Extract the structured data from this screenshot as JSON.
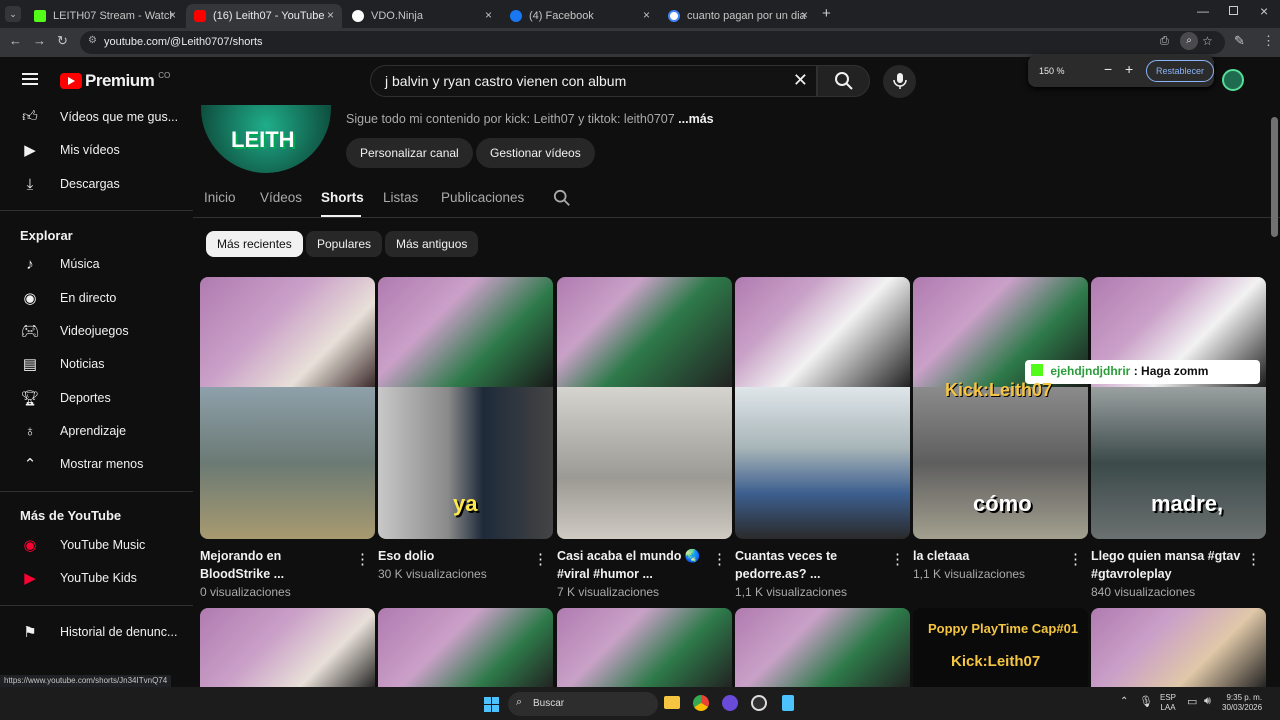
{
  "browser": {
    "tabs": [
      {
        "title": "LEITH07 Stream - Watch Live on",
        "color": "#53fc18"
      },
      {
        "title": "(16) Leith07 - YouTube",
        "color": "#ff0000"
      },
      {
        "title": "VDO.Ninja",
        "color": "#ffffff"
      },
      {
        "title": "(4) Facebook",
        "color": "#1877f2"
      },
      {
        "title": "cuanto pagan por un dia de tra",
        "color": "#4285f4"
      }
    ],
    "url": "youtube.com/@Leith0707/shorts",
    "zoom": {
      "value": "150 %",
      "reset": "Restablecer"
    }
  },
  "yt": {
    "logo": "Premium",
    "country": "CO",
    "search_value": "j balvin y ryan castro vienen con album"
  },
  "sidebar": {
    "top_items": [
      {
        "label": "Vídeos que me gus...",
        "icon": "like-icon"
      },
      {
        "label": "Mis vídeos",
        "icon": "play-square-icon"
      },
      {
        "label": "Descargas",
        "icon": "download-icon"
      }
    ],
    "explore_header": "Explorar",
    "explore_items": [
      {
        "label": "Música",
        "icon": "music-icon"
      },
      {
        "label": "En directo",
        "icon": "live-icon"
      },
      {
        "label": "Videojuegos",
        "icon": "gamepad-icon"
      },
      {
        "label": "Noticias",
        "icon": "news-icon"
      },
      {
        "label": "Deportes",
        "icon": "trophy-icon"
      },
      {
        "label": "Aprendizaje",
        "icon": "bulb-icon"
      },
      {
        "label": "Mostrar menos",
        "icon": "chevron-up-icon"
      }
    ],
    "more_header": "Más de YouTube",
    "more_items": [
      {
        "label": "YouTube Music"
      },
      {
        "label": "YouTube Kids"
      }
    ],
    "report_history": "Historial de denunc..."
  },
  "channel": {
    "description": "Sigue todo mi contenido por kick: Leith07 y tiktok: leith0707",
    "more": "...más",
    "avatar_text": "LEITH",
    "customize": "Personalizar canal",
    "manage": "Gestionar vídeos",
    "tabs": [
      "Inicio",
      "Vídeos",
      "Shorts",
      "Listas",
      "Publicaciones"
    ],
    "active_tab": "Shorts"
  },
  "filters": [
    "Más recientes",
    "Populares",
    "Más antiguos"
  ],
  "shorts": [
    {
      "title": "Mejorando en BloodStrike ...",
      "views": "0 visualizaciones",
      "caption": ""
    },
    {
      "title": "Eso dolio",
      "views": "30 K visualizaciones",
      "caption": "ya"
    },
    {
      "title": "Casi acaba el mundo 🌏 #viral #humor ...",
      "views": "7 K visualizaciones",
      "caption": ""
    },
    {
      "title": "Cuantas veces te pedorre.as? ...",
      "views": "1,1 K visualizaciones",
      "caption": ""
    },
    {
      "title": "la cletaaa",
      "views": "1,1 K visualizaciones",
      "caption": "cómo"
    },
    {
      "title": "Llego quien mansa #gtav #gtavroleplay",
      "views": "840 visualizaciones",
      "caption": "madre,"
    }
  ],
  "overlays": {
    "kick_chat_user": "ejehdjndjdhrir",
    "kick_chat_msg": ": Haga zomm",
    "kick_tag": "Kick:Leith07",
    "poppy_title": "Poppy PlayTime Cap#01",
    "poppy_kick": "Kick:Leith07"
  },
  "status_url": "https://www.youtube.com/shorts/Jn34ITvnQ74",
  "taskbar": {
    "search": "Buscar",
    "lang1": "ESP",
    "lang2": "LAA",
    "time": "9:35 p. m.",
    "date": "30/03/2026"
  }
}
